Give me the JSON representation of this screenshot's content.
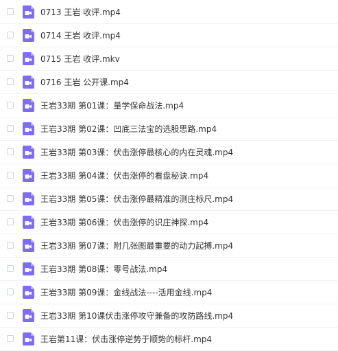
{
  "files": [
    {
      "name": "0713 王岩 收评.mp4",
      "icon": "video-file-icon"
    },
    {
      "name": "0714 王岩 收评.mp4",
      "icon": "video-file-icon"
    },
    {
      "name": "0715 王岩 收评.mkv",
      "icon": "video-file-icon"
    },
    {
      "name": "0716 王岩 公开课.mp4",
      "icon": "video-file-icon"
    },
    {
      "name": "王岩33期 第01课：量学保命战法.mp4",
      "icon": "video-file-icon"
    },
    {
      "name": "王岩33期 第02课：凹底三法宝的选股思路.mp4",
      "icon": "video-file-icon"
    },
    {
      "name": "王岩33期 第03课：伏击涨停最核心的内在灵魂.mp4",
      "icon": "video-file-icon"
    },
    {
      "name": "王岩33期 第04课：伏击涨停的看盘秘诀.mp4",
      "icon": "video-file-icon"
    },
    {
      "name": "王岩33期 第05课：伏击涨停最精准的测庄标尺.mp4",
      "icon": "video-file-icon"
    },
    {
      "name": "王岩33期 第06课：伏击涨停的识庄神探.mp4",
      "icon": "video-file-icon"
    },
    {
      "name": "王岩33期 第07课：附几张图最重要的动力起搏.mp4",
      "icon": "video-file-icon"
    },
    {
      "name": "王岩33期 第08课：零号战法.mp4",
      "icon": "video-file-icon"
    },
    {
      "name": "王岩33期 第09课：金线战法----活用金线.mp4",
      "icon": "video-file-icon"
    },
    {
      "name": "王岩33期 第10课伏击涨停攻守兼备的攻防路线.mp4",
      "icon": "video-file-icon"
    },
    {
      "name": "王岩第11课：伏击涨停逆势于顺势的标杆.mp4",
      "icon": "video-file-icon"
    }
  ],
  "colors": {
    "icon_purple": "#7e6cf6",
    "text": "#333333",
    "divider": "#f1f2f4"
  }
}
